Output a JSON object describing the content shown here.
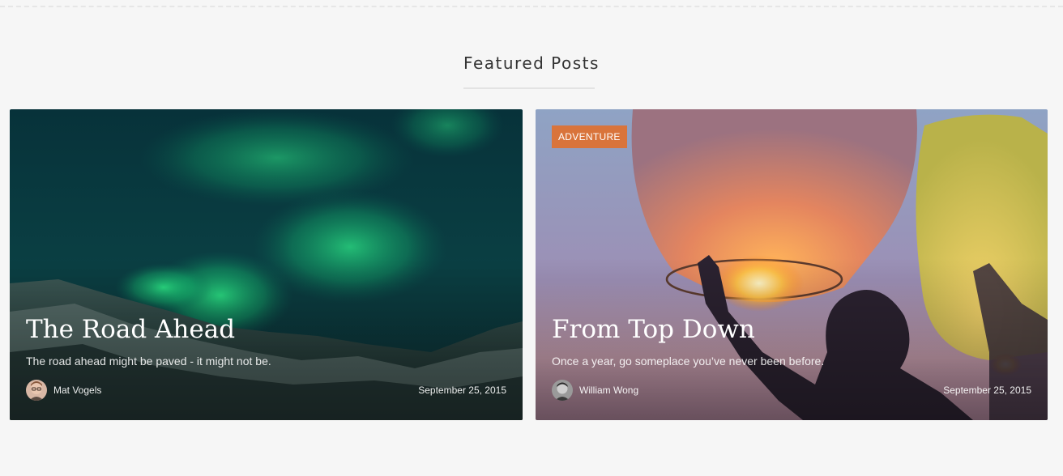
{
  "section": {
    "title": "Featured Posts"
  },
  "posts": [
    {
      "title": "The Road Ahead",
      "excerpt": "The road ahead might be paved - it might not be.",
      "author": "Mat Vogels",
      "date": "September 25, 2015",
      "category": ""
    },
    {
      "title": "From Top Down",
      "excerpt": "Once a year, go someplace you’ve never been before.",
      "author": "William Wong",
      "date": "September 25, 2015",
      "category": "ADVENTURE"
    }
  ],
  "colors": {
    "badge": "#d9743b",
    "page_background": "#f6f6f6"
  }
}
